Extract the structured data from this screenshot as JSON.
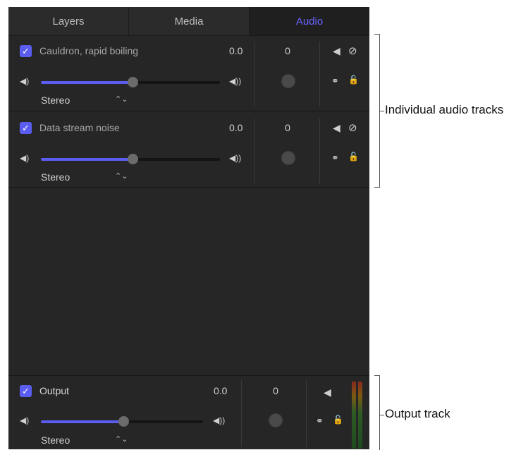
{
  "tabs": [
    {
      "label": "Layers",
      "active": false
    },
    {
      "label": "Media",
      "active": false
    },
    {
      "label": "Audio",
      "active": true
    }
  ],
  "tracks": [
    {
      "name": "Cauldron, rapid boiling",
      "checked": true,
      "level": "0.0",
      "pan": "0",
      "mode": "Stereo",
      "volume_fraction": 0.51
    },
    {
      "name": "Data stream noise",
      "checked": true,
      "level": "0.0",
      "pan": "0",
      "mode": "Stereo",
      "volume_fraction": 0.51
    }
  ],
  "output": {
    "name": "Output",
    "checked": true,
    "level": "0.0",
    "pan": "0",
    "mode": "Stereo",
    "volume_fraction": 0.51
  },
  "icons": {
    "checkmark": "✓",
    "volume_low": "◀)",
    "volume_high": "◀))",
    "chevron_updown": "⌃⌄",
    "speaker": "◀",
    "mute": "⊘",
    "solo": "ⓢ",
    "lock": "🔓",
    "link": "⚭"
  },
  "callouts": {
    "tracks": "Individual audio tracks",
    "output": "Output track"
  },
  "colors": {
    "accent": "#5b5cf0",
    "active_tab": "#6a63ff",
    "panel_bg": "#262626"
  }
}
